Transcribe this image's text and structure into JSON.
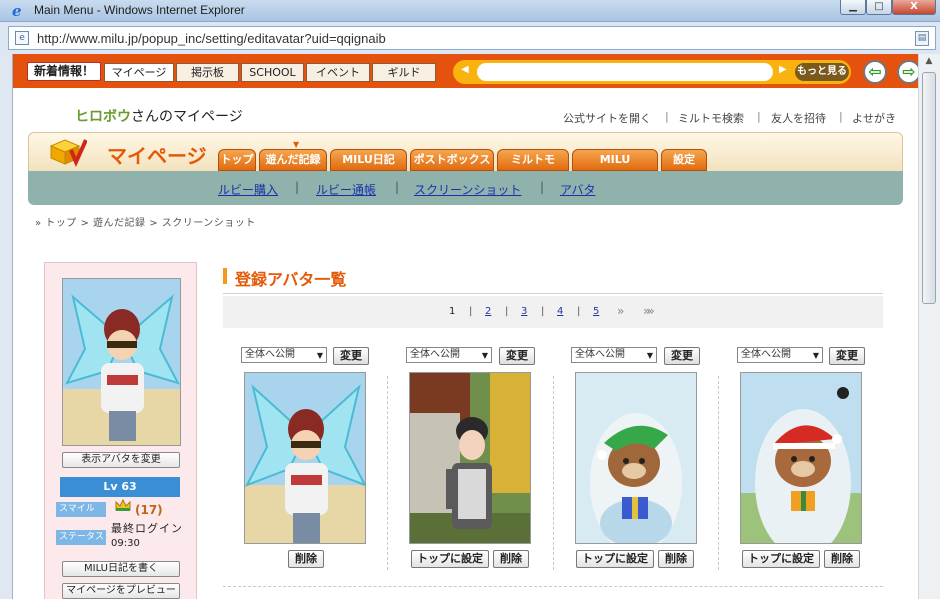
{
  "window": {
    "title": "Main Menu - Windows Internet Explorer",
    "min_glyph": "▁",
    "max_glyph": "□",
    "close_glyph": "X"
  },
  "address": {
    "url": "http://www.milu.jp/popup_inc/setting/editavatar?uid=qqignaib"
  },
  "topbar": {
    "news_label": "新着情報！",
    "tabs": [
      "マイページ",
      "掲示板",
      "SCHOOL",
      "イベント",
      "ギルド"
    ],
    "more_label": "もっと見る"
  },
  "header": {
    "user_name": "ヒロボウ",
    "user_suffix": "さんのマイページ",
    "links": [
      "公式サイトを開く",
      "ミルトモ検索",
      "友人を招待",
      "よせがき"
    ],
    "separator": "|"
  },
  "mypage_nav": {
    "logo_label": "マイページ",
    "tabs": [
      "トップ",
      "遊んだ記録",
      "MILU日記",
      "ポストボックス",
      "ミルトモ",
      "MILU SCHOOL",
      "設定"
    ],
    "sub_links": [
      "ルビー購入",
      "ルビー通帳",
      "スクリーンショット",
      "アバタ"
    ]
  },
  "breadcrumb": "» トップ > 遊んだ記録 > スクリーンショット",
  "profile": {
    "change_avatar_button": "表示アバタを変更",
    "level": "Lv 63",
    "smile_tag": "スマイル",
    "status_tag": "ステータス",
    "count": "(17)",
    "last_login_label": "最終ログイン",
    "last_login_time": "09:30",
    "write_diary_button": "MILU日記を書く",
    "preview_button": "マイページをプレビュー"
  },
  "avatar_list": {
    "title": "登録アバタ一覧",
    "pages": [
      "1",
      "2",
      "3",
      "4",
      "5"
    ],
    "current_page": "1",
    "next_glyph": "»",
    "last_glyph": "»»",
    "visibility_option": "全体へ公開",
    "change_button": "変更",
    "delete_button": "削除",
    "set_top_button": "トップに設定"
  }
}
